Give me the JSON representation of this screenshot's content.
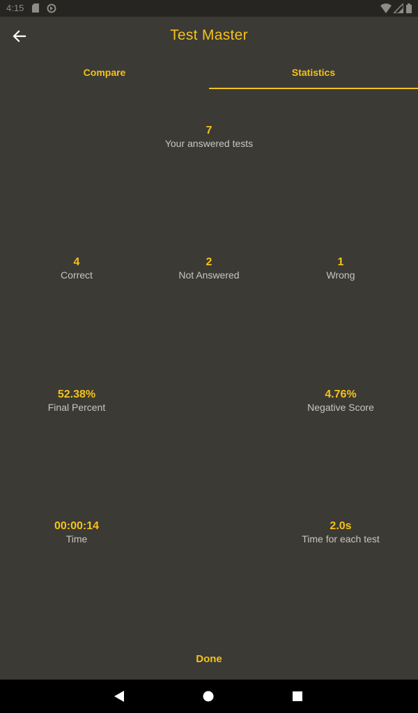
{
  "status_bar": {
    "time": "4:15",
    "icons": [
      "sd-card-icon",
      "sync-icon",
      "wifi-icon",
      "signal-icon",
      "battery-icon"
    ]
  },
  "app_bar": {
    "title": "Test Master",
    "back_icon": "arrow-back-icon"
  },
  "tabs": [
    {
      "label": "Compare",
      "selected": false
    },
    {
      "label": "Statistics",
      "selected": true
    }
  ],
  "stats": {
    "answered": {
      "value": "7",
      "label": "Your answered tests"
    },
    "correct": {
      "value": "4",
      "label": "Correct"
    },
    "not_answered": {
      "value": "2",
      "label": "Not Answered"
    },
    "wrong": {
      "value": "1",
      "label": "Wrong"
    },
    "final_percent": {
      "value": "52.38%",
      "label": "Final Percent"
    },
    "negative_score": {
      "value": "4.76%",
      "label": "Negative Score"
    },
    "time": {
      "value": "00:00:14",
      "label": "Time"
    },
    "time_each": {
      "value": "2.0s",
      "label": "Time for each test"
    }
  },
  "done_label": "Done",
  "nav_bar": {
    "icons": [
      "nav-back-icon",
      "nav-home-icon",
      "nav-recents-icon"
    ]
  },
  "colors": {
    "background": "#3b3a34",
    "accent": "#f5c21b",
    "label": "#c9c7bf",
    "status_bar": "#262521",
    "nav_bar": "#000000"
  }
}
